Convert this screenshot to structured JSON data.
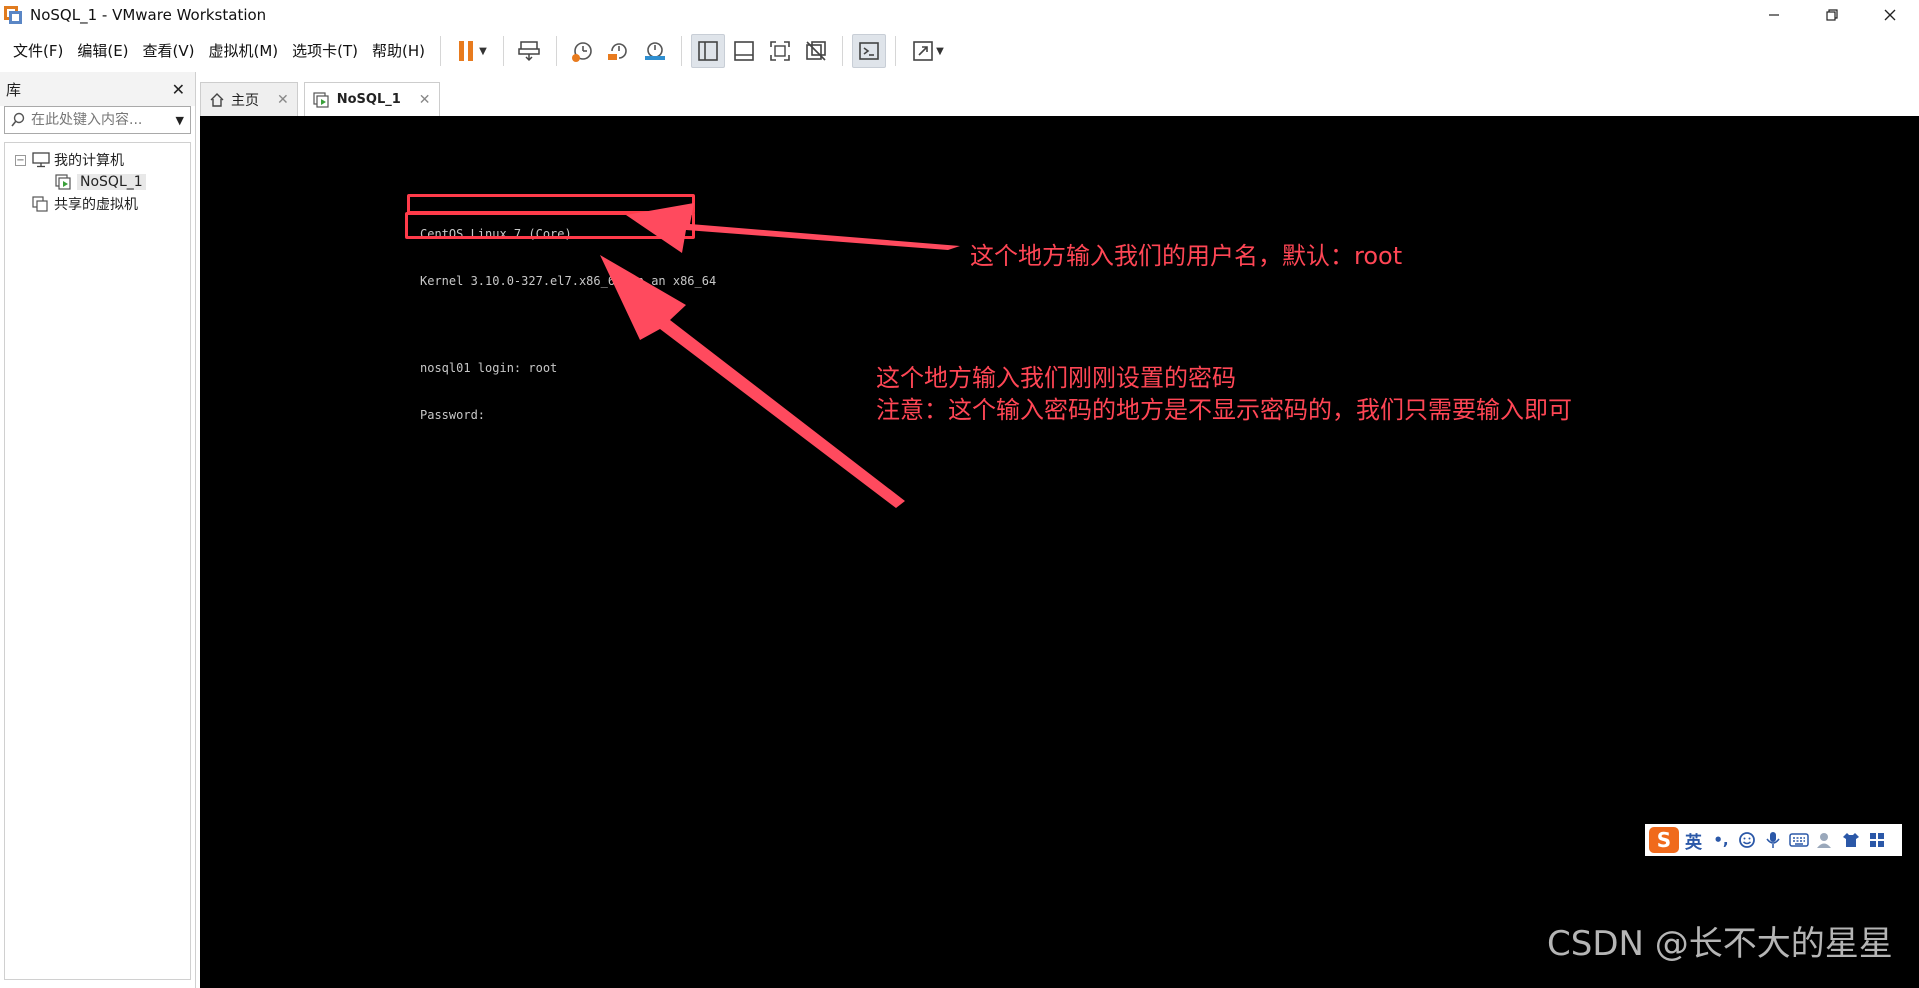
{
  "window": {
    "title": "NoSQL_1 - VMware Workstation",
    "minimize_icon": "minimize-icon",
    "restore_icon": "restore-icon",
    "close_icon": "close-icon"
  },
  "menu": {
    "items": [
      "文件(F)",
      "编辑(E)",
      "查看(V)",
      "虚拟机(M)",
      "选项卡(T)",
      "帮助(H)"
    ]
  },
  "toolbar": {
    "icons": [
      "pause-icon",
      "send-ctrl-alt-del-icon",
      "snapshot-icon",
      "revert-snapshot-icon",
      "snapshot-manager-icon",
      "library-view-icon",
      "thumbnail-view-icon",
      "fullscreen-icon",
      "unity-icon",
      "console-view-icon",
      "stretch-icon"
    ],
    "accent_color": "#e87b1e"
  },
  "sidebar": {
    "title": "库",
    "search_placeholder": "在此处键入内容...",
    "tree": {
      "root": "我的计算机",
      "vm": "NoSQL_1",
      "shared": "共享的虚拟机"
    }
  },
  "tabs": [
    {
      "label": "主页",
      "icon": "home-icon"
    },
    {
      "label": "NoSQL_1",
      "icon": "vm-running-icon"
    }
  ],
  "console": {
    "lines": [
      "CentOS Linux 7 (Core)",
      "Kernel 3.10.0-327.el7.x86_64 on an x86_64"
    ],
    "login_line": "nosql01 login: root",
    "password_line": "Password:"
  },
  "annotations": {
    "color": "#ff3b4a",
    "username_note": "这个地方输入我们的用户名，默认：root",
    "password_note_1": "这个地方输入我们刚刚设置的密码",
    "password_note_2": "注意：这个输入密码的地方是不显示密码的，我们只需要输入即可"
  },
  "ime": {
    "logo": "S",
    "mode": "英",
    "punct": "•,"
  },
  "watermark": "CSDN @长不大的星星"
}
